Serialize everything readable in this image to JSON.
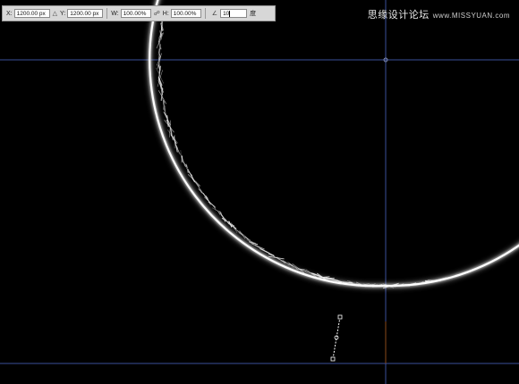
{
  "options_bar": {
    "x_label": "X:",
    "x_value": "1200.00 px",
    "y_label": "Y:",
    "y_value": "1200.00 px",
    "w_label": "W:",
    "w_value": "100.00%",
    "h_label": "H:",
    "h_value": "100.00%",
    "angle_value": "10",
    "angle_unit": "度",
    "delta_icon": "delta-triangle-icon",
    "link_icon": "chain-link-icon",
    "angle_icon": "rotate-angle-icon"
  },
  "watermark": {
    "text": "思缘设计论坛",
    "url": "www.MISSYUAN.com"
  },
  "colors": {
    "canvas_background": "#000000",
    "guide_line": "#3a4f9a",
    "glow": "#ffffff",
    "options_bar_bg": "#d7d7d7"
  }
}
